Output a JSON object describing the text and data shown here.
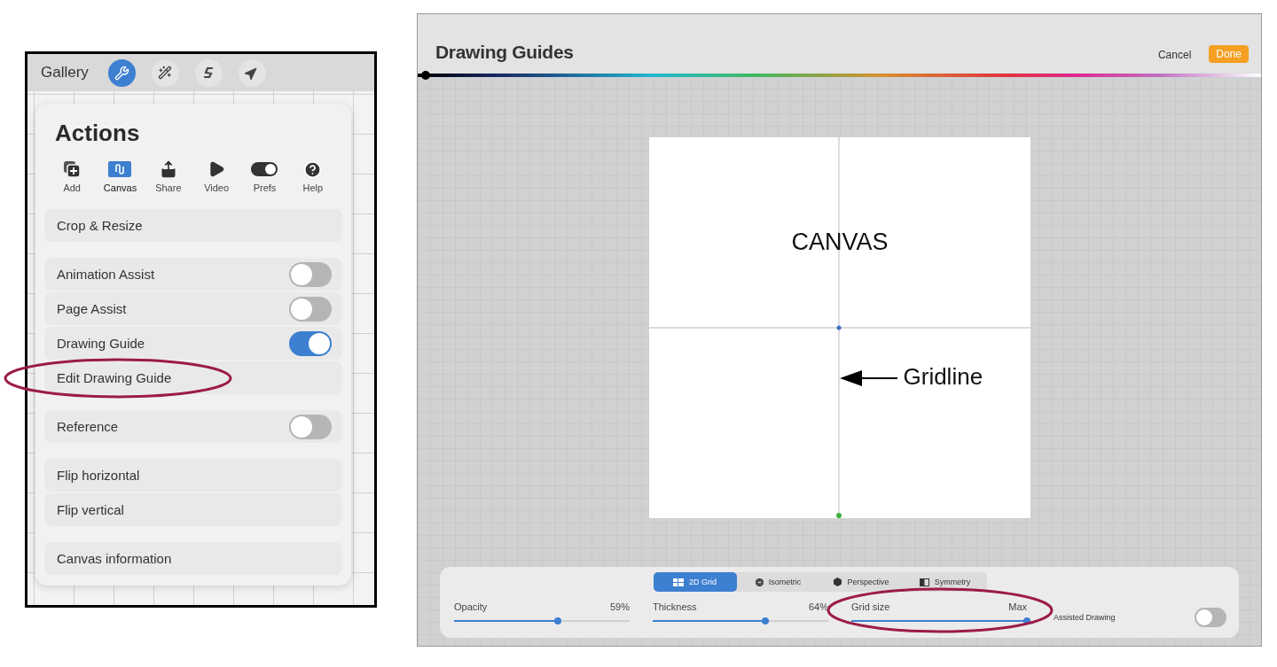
{
  "actions_screen": {
    "gallery": "Gallery",
    "tools": [
      {
        "selected": true
      },
      {
        "selected": false
      },
      {
        "selected": false
      },
      {
        "selected": false
      }
    ],
    "title": "Actions",
    "tabs": [
      {
        "label": "Add",
        "selected": false
      },
      {
        "label": "Canvas",
        "selected": true
      },
      {
        "label": "Share",
        "selected": false
      },
      {
        "label": "Video",
        "selected": false
      },
      {
        "label": "Prefs",
        "selected": false
      },
      {
        "label": "Help",
        "selected": false
      }
    ],
    "groups": [
      {
        "items": [
          {
            "label": "Crop & Resize",
            "kind": "link",
            "highlighted": false
          }
        ]
      },
      {
        "items": [
          {
            "label": "Animation Assist",
            "kind": "toggle",
            "on": false,
            "highlighted": false
          },
          {
            "label": "Page Assist",
            "kind": "toggle",
            "on": false,
            "highlighted": false
          },
          {
            "label": "Drawing Guide",
            "kind": "toggle",
            "on": true,
            "highlighted": false
          },
          {
            "label": "Edit Drawing Guide",
            "kind": "link",
            "highlighted": true
          }
        ]
      },
      {
        "items": [
          {
            "label": "Reference",
            "kind": "toggle",
            "on": false,
            "highlighted": false
          }
        ]
      },
      {
        "items": [
          {
            "label": "Flip horizontal",
            "kind": "link",
            "highlighted": false
          },
          {
            "label": "Flip vertical",
            "kind": "link",
            "highlighted": false
          }
        ]
      },
      {
        "items": [
          {
            "label": "Canvas information",
            "kind": "link",
            "highlighted": false
          }
        ]
      }
    ]
  },
  "guides_screen": {
    "title": "Drawing Guides",
    "cancel": "Cancel",
    "done": "Done",
    "color_slider": {
      "level": 0
    },
    "canvas_label": "CANVAS",
    "callout": "Gridline",
    "modes": [
      {
        "label": "2D Grid",
        "selected": true
      },
      {
        "label": "Isometric",
        "selected": false
      },
      {
        "label": "Perspective",
        "selected": false
      },
      {
        "label": "Symmetry",
        "selected": false
      }
    ],
    "sliders": [
      {
        "label": "Opacity",
        "reading": "59%",
        "level": 0.59,
        "highlighted": false
      },
      {
        "label": "Thickness",
        "reading": "64%",
        "level": 0.64,
        "highlighted": false
      },
      {
        "label": "Grid size",
        "reading": "Max",
        "level": 1,
        "highlighted": true
      }
    ],
    "assisted_drawing": {
      "label": "Assisted Drawing",
      "on": false
    }
  }
}
